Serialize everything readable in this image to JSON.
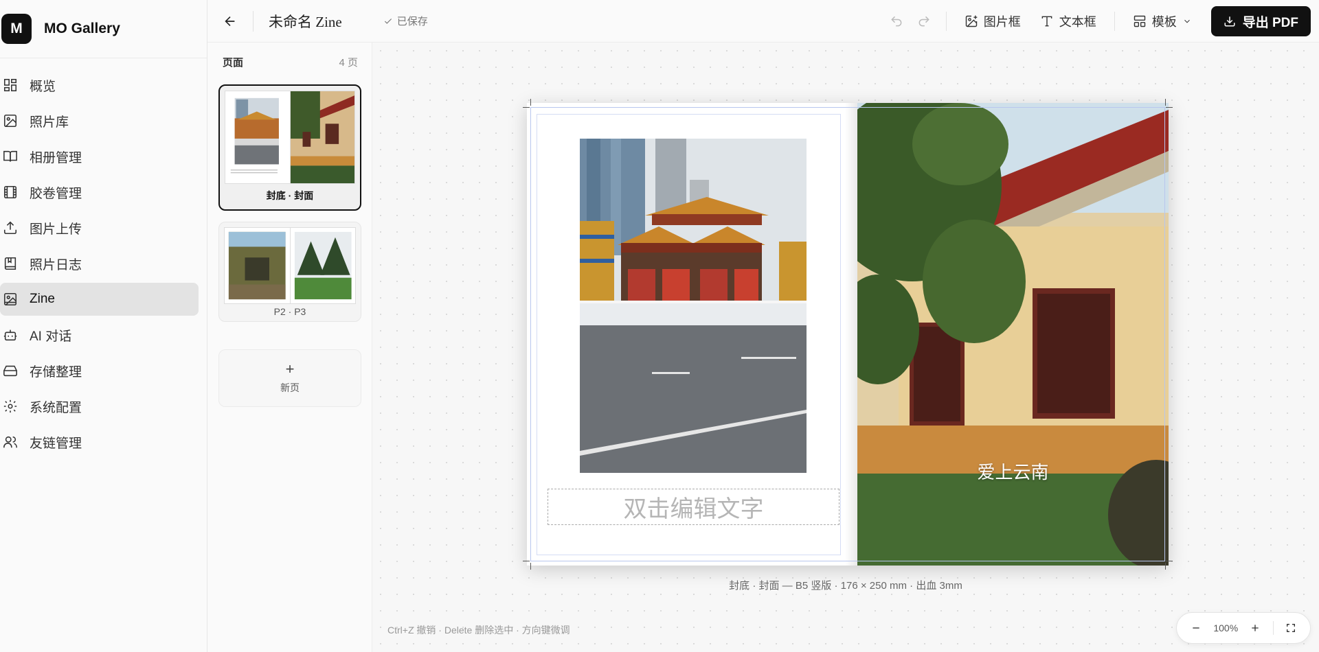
{
  "brand": {
    "logo_letter": "M",
    "name": "MO Gallery"
  },
  "sidebar": {
    "items": [
      {
        "label": "概览",
        "icon": "dashboard-icon"
      },
      {
        "label": "照片库",
        "icon": "image-icon"
      },
      {
        "label": "相册管理",
        "icon": "book-icon"
      },
      {
        "label": "胶卷管理",
        "icon": "film-icon"
      },
      {
        "label": "图片上传",
        "icon": "upload-icon"
      },
      {
        "label": "照片日志",
        "icon": "journal-icon"
      },
      {
        "label": "Zine",
        "icon": "photo-book-icon",
        "active": true
      },
      {
        "label": "AI 对话",
        "icon": "bot-icon"
      },
      {
        "label": "存储整理",
        "icon": "storage-icon"
      },
      {
        "label": "系统配置",
        "icon": "gear-icon"
      },
      {
        "label": "友链管理",
        "icon": "users-icon"
      }
    ]
  },
  "toolbar": {
    "title": "未命名 Zine",
    "saved_label": "已保存",
    "image_frame_label": "图片框",
    "text_frame_label": "文本框",
    "template_label": "模板",
    "export_label": "导出 PDF"
  },
  "pages_panel": {
    "title": "页面",
    "count_label": "4 页",
    "cards": [
      {
        "label": "封底 · 封面",
        "selected": true
      },
      {
        "label": "P2 · P3",
        "selected": false
      }
    ],
    "new_page_symbol": "+",
    "new_page_label": "新页"
  },
  "canvas": {
    "text_placeholder": "双击编辑文字",
    "cover_text": "爱上云南",
    "caption": "封底 · 封面  —  B5 竖版 · 176 × 250 mm · 出血 3mm",
    "hint": "Ctrl+Z 撤销 · Delete 删除选中 · 方向键微调"
  },
  "zoom": {
    "value": "100%"
  },
  "colors": {
    "accent": "#111111",
    "guide": "#b8c6ee",
    "active_nav": "#e3e3e3"
  }
}
